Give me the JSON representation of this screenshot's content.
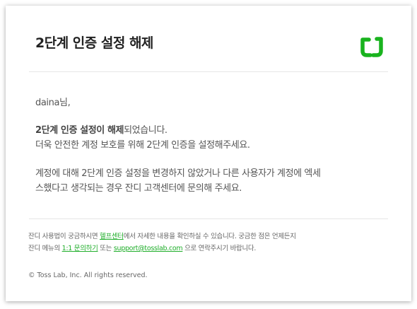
{
  "email": {
    "title": "2단계 인증 설정 해제",
    "brand_color": "#19b31e",
    "logo_icon": "jandi-logo-icon",
    "greeting": "daina님,",
    "notice": {
      "bold": "2단계 인증 설정이 해제",
      "line1_rest": "되었습니다.",
      "line2": "더욱 안전한 계정 보호를 위해 2단계 인증을 설정해주세요."
    },
    "warning": {
      "line1": "계정에 대해 2단계 인증 설정을 변경하지 않았거나 다른 사용자가 계정에 엑세",
      "line2": "스했다고 생각되는 경우 잔디 고객센터에 문의해 주세요."
    },
    "footer": {
      "line1_prefix": "잔디 사용법이 궁금하시면 ",
      "help_center_link": "헬프센터",
      "line1_suffix": "에서 자세한 내용을 확인하실 수 있습니다. 궁금한 점은 언제든지",
      "line2_prefix": "잔디 메뉴의 ",
      "inquiry_link": "1:1 문의하기",
      "line2_middle": " 또는 ",
      "support_email_link": "support@tosslab.com",
      "line2_suffix": " 으로 연락주시기 바랍니다.",
      "link_color": "#1fae2a"
    },
    "copyright": "© Toss Lab, Inc. All rights reserved."
  }
}
